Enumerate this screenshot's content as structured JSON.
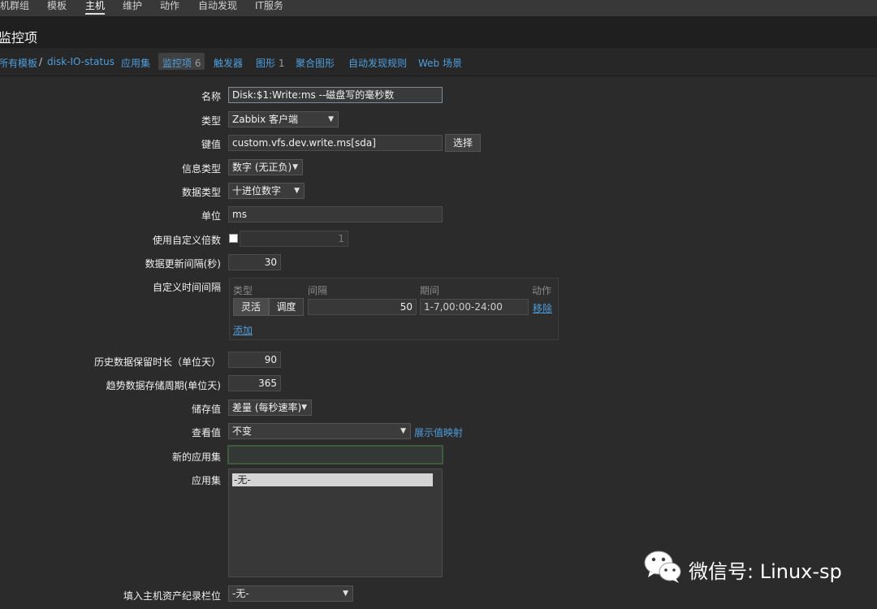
{
  "topnav": {
    "items": [
      "机群组",
      "模板",
      "主机",
      "维护",
      "动作",
      "自动发现",
      "IT服务"
    ]
  },
  "page": {
    "title": "监控项"
  },
  "breadcrumb": {
    "all_templates": "所有模板",
    "separator": "/",
    "template": "disk-IO-status",
    "tabs": [
      "应用集",
      "监控项",
      "触发器",
      "图形",
      "聚合图形",
      "自动发现规则",
      "Web 场景"
    ],
    "items_count": "6",
    "graphs_count": "1"
  },
  "form": {
    "name_label": "名称",
    "name_value": "Disk:$1:Write:ms --磁盘写的毫秒数",
    "type_label": "类型",
    "type_value": "Zabbix 客户端",
    "key_label": "键值",
    "key_value": "custom.vfs.dev.write.ms[sda]",
    "key_select_button": "选择",
    "info_type_label": "信息类型",
    "info_type_value": "数字 (无正负)",
    "data_type_label": "数据类型",
    "data_type_value": "十进位数字",
    "units_label": "单位",
    "units_value": "ms",
    "multiplier_label": "使用自定义倍数",
    "multiplier_value": "1",
    "interval_label": "数据更新间隔(秒)",
    "interval_value": "30",
    "custom_intervals_label": "自定义时间间隔",
    "custom_intervals": {
      "col_type": "类型",
      "col_interval": "间隔",
      "col_period": "期间",
      "col_action": "动作",
      "flexible": "灵活",
      "scheduling": "调度",
      "interval_value": "50",
      "period_value": "1-7,00:00-24:00",
      "remove": "移除",
      "add": "添加"
    },
    "history_label": "历史数据保留时长（单位天）",
    "history_value": "90",
    "trends_label": "趋势数据存储周期(单位天)",
    "trends_value": "365",
    "store_value_label": "储存值",
    "store_value": "差量 (每秒速率)",
    "show_value_label": "查看值",
    "show_value": "不变",
    "value_mapping_link": "展示值映射",
    "new_application_label": "新的应用集",
    "new_application_value": "",
    "applications_label": "应用集",
    "applications_options": [
      "-无-"
    ],
    "inventory_label": "填入主机资产纪录栏位",
    "inventory_value": "-无-"
  },
  "watermark": {
    "text": "微信号: Linux-sp"
  }
}
